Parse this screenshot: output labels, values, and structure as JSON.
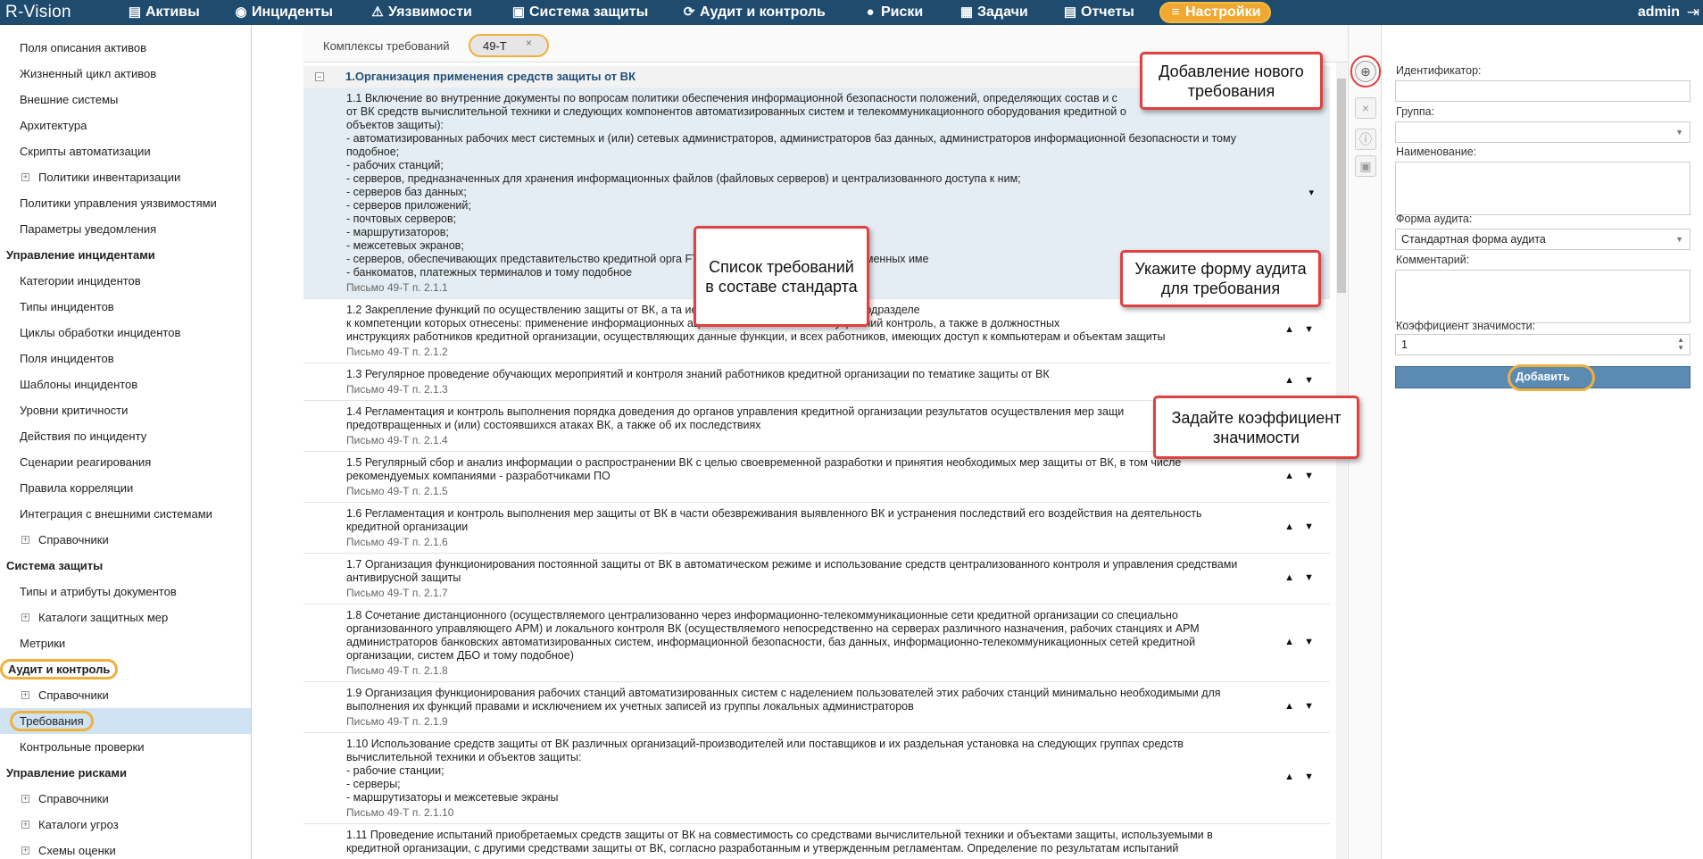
{
  "app": {
    "logo": "R-Vision"
  },
  "nav": [
    {
      "label": "Активы",
      "icon": "database-icon"
    },
    {
      "label": "Инциденты",
      "icon": "target-icon"
    },
    {
      "label": "Уязвимости",
      "icon": "warning-icon"
    },
    {
      "label": "Система защиты",
      "icon": "shield-icon"
    },
    {
      "label": "Аудит и контроль",
      "icon": "refresh-icon"
    },
    {
      "label": "Риски",
      "icon": "alert-icon"
    },
    {
      "label": "Задачи",
      "icon": "tasks-icon"
    },
    {
      "label": "Отчеты",
      "icon": "reports-icon"
    },
    {
      "label": "Настройки",
      "icon": "menu-icon"
    }
  ],
  "user": {
    "name": "admin",
    "logout_icon": "logout-icon"
  },
  "sidebar": {
    "items": [
      {
        "label": "Поля описания активов",
        "type": "item"
      },
      {
        "label": "Жизненный цикл активов",
        "type": "item"
      },
      {
        "label": "Внешние системы",
        "type": "item"
      },
      {
        "label": "Архитектура",
        "type": "item"
      },
      {
        "label": "Скрипты автоматизации",
        "type": "item"
      },
      {
        "label": "Политики инвентаризации",
        "type": "expandable"
      },
      {
        "label": "Политики управления уязвимостями",
        "type": "item"
      },
      {
        "label": "Параметры уведомления",
        "type": "item"
      },
      {
        "label": "Управление инцидентами",
        "type": "header"
      },
      {
        "label": "Категории инцидентов",
        "type": "item"
      },
      {
        "label": "Типы инцидентов",
        "type": "item"
      },
      {
        "label": "Циклы обработки инцидентов",
        "type": "item"
      },
      {
        "label": "Поля инцидентов",
        "type": "item"
      },
      {
        "label": "Шаблоны инцидентов",
        "type": "item"
      },
      {
        "label": "Уровни критичности",
        "type": "item"
      },
      {
        "label": "Действия по инциденту",
        "type": "item"
      },
      {
        "label": "Сценарии реагирования",
        "type": "item"
      },
      {
        "label": "Правила корреляции",
        "type": "item"
      },
      {
        "label": "Интеграция с внешними системами",
        "type": "item"
      },
      {
        "label": "Справочники",
        "type": "expandable"
      },
      {
        "label": "Система защиты",
        "type": "header"
      },
      {
        "label": "Типы и атрибуты документов",
        "type": "item"
      },
      {
        "label": "Каталоги защитных мер",
        "type": "expandable"
      },
      {
        "label": "Метрики",
        "type": "item"
      },
      {
        "label": "Аудит и контроль",
        "type": "header"
      },
      {
        "label": "Справочники",
        "type": "expandable"
      },
      {
        "label": "Требования",
        "type": "active"
      },
      {
        "label": "Контрольные проверки",
        "type": "item"
      },
      {
        "label": "Управление рисками",
        "type": "header"
      },
      {
        "label": "Справочники",
        "type": "expandable"
      },
      {
        "label": "Каталоги угроз",
        "type": "expandable"
      },
      {
        "label": "Схемы оценки",
        "type": "expandable"
      }
    ]
  },
  "tabs": {
    "label": "Комплексы требований",
    "active_tab": "49-Т",
    "close": "×"
  },
  "group": {
    "title": "1.Организация применения средств защиты от ВК",
    "toggle": "−"
  },
  "requirements": [
    {
      "text": "1.1 Включение во внутренние документы по вопросам политики обеспечения информационной безопасности положений, определяющих состав и с\nот ВК средств вычислительной техники и следующих компонентов автоматизированных систем и телекоммуникационного оборудования кредитной о\nобъектов защиты):\n- автоматизированных рабочих мест системных и (или) сетевых администраторов, администраторов баз данных, администраторов информационной безопасности и тому\nподобное;\n- рабочих станций;\n- серверов, предназначенных для хранения информационных файлов (файловых серверов) и централизованного доступа к ним;\n- серверов баз данных;\n- серверов приложений;\n- почтовых серверов;\n- маршрутизаторов;\n- межсетевых экранов;\n- серверов, обеспечивающих представительство кредитной орга                                                                                 FTP-, proxy-серверов, серверов доменных име\n- банкоматов, платежных терминалов и тому подобное",
      "source": "Письмо 49-Т п. 2.1.1",
      "arrows": "▾"
    },
    {
      "text": "1.2 Закрепление функций по осуществлению защиты от ВК, а та                                                                                 ием в положениях о структурных подразделе\nк компетенции которых отнесены: применение информационных                                                                                 ационной безопасности и внутренний контроль, а также в должностных\nинструкциях работников кредитной организации, осуществляющих данные функции, и всех работников, имеющих доступ к компьютерам и объектам защиты",
      "source": "Письмо 49-Т п. 2.1.2",
      "arrows": "▲ ▼"
    },
    {
      "text": "1.3 Регулярное проведение обучающих мероприятий и контроля знаний работников кредитной организации по тематике защиты от ВК",
      "source": "Письмо 49-Т п. 2.1.3",
      "arrows": "▲ ▼"
    },
    {
      "text": "1.4 Регламентация и контроль выполнения порядка доведения до органов управления кредитной организации результатов осуществления мер защи\nпредотвращенных и (или) состоявшихся атаках ВК, а также об их последствиях",
      "source": "Письмо 49-Т п. 2.1.4",
      "arrows": "▲ ▼"
    },
    {
      "text": "1.5 Регулярный сбор и анализ информации о распространении ВК с целью своевременной разработки и принятия необходимых мер защиты от ВК, в том числе\nрекомендуемых компаниями - разработчиками ПО",
      "source": "Письмо 49-Т п. 2.1.5",
      "arrows": "▲ ▼"
    },
    {
      "text": "1.6 Регламентация и контроль выполнения мер защиты от ВК в части обезвреживания выявленного ВК и устранения последствий его воздействия на деятельность\nкредитной организации",
      "source": "Письмо 49-Т п. 2.1.6",
      "arrows": "▲ ▼"
    },
    {
      "text": "1.7 Организация функционирования постоянной защиты от ВК в автоматическом режиме и использование средств централизованного контроля и управления средствами\nантивирусной защиты",
      "source": "Письмо 49-Т п. 2.1.7",
      "arrows": "▲ ▼"
    },
    {
      "text": "1.8 Сочетание дистанционного (осуществляемого централизованно через информационно-телекоммуникационные сети кредитной организации со специально\nорганизованного управляющего АРМ) и локального контроля ВК (осуществляемого непосредственно на серверах различного назначения, рабочих станциях и АРМ\nадминистраторов банковских автоматизированных систем, информационной безопасности, баз данных, информационно-телекоммуникационных сетей кредитной\nорганизации, систем ДБО и тому подобное)",
      "source": "Письмо 49-Т п. 2.1.8",
      "arrows": "▲ ▼"
    },
    {
      "text": "1.9 Организация функционирования рабочих станций автоматизированных систем с наделением пользователей этих рабочих станций минимально необходимыми для\nвыполнения их функций правами и исключением их учетных записей из группы локальных администраторов",
      "source": "Письмо 49-Т п. 2.1.9",
      "arrows": "▲ ▼"
    },
    {
      "text": "1.10 Использование средств защиты от ВК различных организаций-производителей или поставщиков и их раздельная установка на следующих группах средств\nвычислительной техники и объектов защиты:\n- рабочие станции;\n- серверы;\n- маршрутизаторы и межсетевые экраны",
      "source": "Письмо 49-Т п. 2.1.10",
      "arrows": "▲ ▼"
    },
    {
      "text": "1.11 Проведение испытаний приобретаемых средств защиты от ВК на совместимость со средствами вычислительной техники и объектами защиты, используемыми в\nкредитной организации, с другими средствами защиты от ВК, согласно разработанным и утвержденным регламентам. Определение по результатам испытаний",
      "source": "",
      "arrows": ""
    }
  ],
  "toolbar": {
    "add_icon": "add-circle-icon",
    "add_glyph": "⊕",
    "delete_glyph": "×",
    "info_glyph": "ⓘ",
    "clipboard_glyph": "▣"
  },
  "form": {
    "identifier": {
      "label": "Идентификатор:",
      "value": ""
    },
    "group": {
      "label": "Группа:",
      "value": ""
    },
    "name": {
      "label": "Наименование:",
      "value": ""
    },
    "audit_form": {
      "label": "Форма аудита:",
      "value": "Стандартная форма аудита"
    },
    "comment": {
      "label": "Комментарий:",
      "value": ""
    },
    "weight": {
      "label": "Коэффициент значимости:",
      "value": "1"
    },
    "submit": "Добавить"
  },
  "callouts": {
    "add_new": "Добавление нового\nтребования",
    "list": "Список требований\nв составе стандарта",
    "audit_form": "Укажите форму аудита\nдля требования",
    "weight": "Задайте коэффициент\nзначимости"
  },
  "colors": {
    "topbar": "#1e4b6e",
    "highlight": "#f0b040",
    "callout_border": "#e04040",
    "active_item": "#cfe3f3",
    "primary_button": "#5b8bb2"
  }
}
